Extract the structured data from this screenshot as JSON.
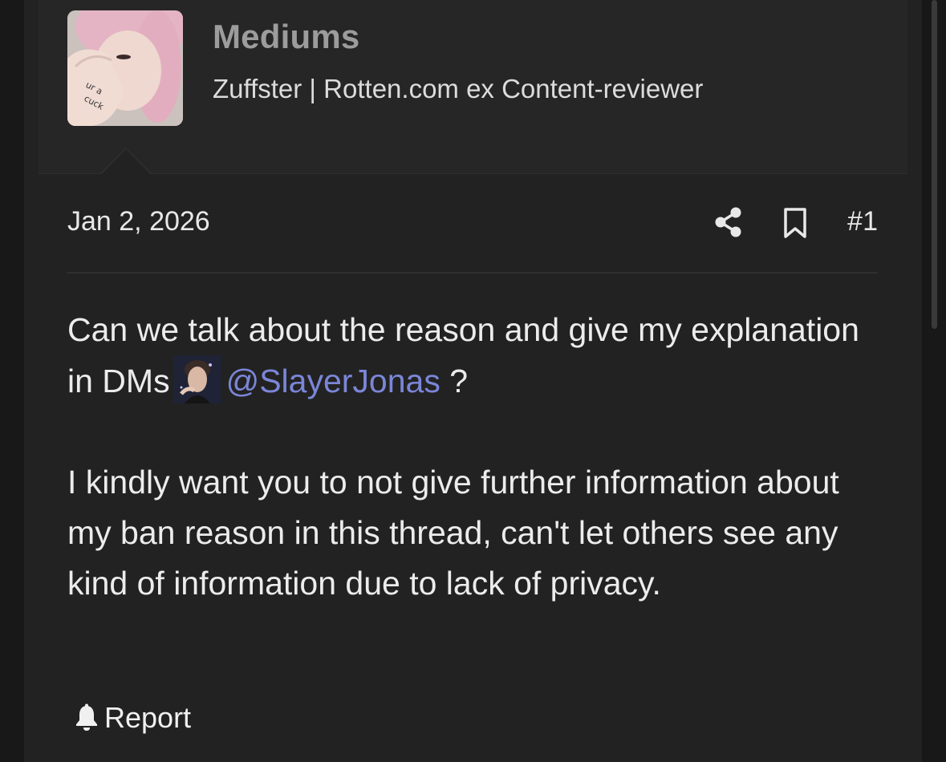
{
  "post": {
    "author": {
      "username": "Mediums",
      "title": "Zuffster | Rotten.com ex Content-reviewer",
      "avatar_text": "ur a cuck"
    },
    "date": "Jan 2, 2026",
    "post_number": "#1",
    "body": {
      "paragraph1_before": "Can we talk about the reason and give my explanation in DMs",
      "mention": "@SlayerJonas",
      "paragraph1_after": "?",
      "paragraph2": "I kindly want you to not give further information about my ban reason in this thread, can't let others see any kind of information due to lack of privacy."
    },
    "report_label": "Report"
  },
  "icons": {
    "share": "share-icon",
    "bookmark": "bookmark-icon",
    "report": "bell-icon"
  },
  "colors": {
    "background": "#181818",
    "post_bg": "#222222",
    "header_bg": "#262626",
    "mention": "#7b86d8",
    "username": "#9c9c9c"
  }
}
